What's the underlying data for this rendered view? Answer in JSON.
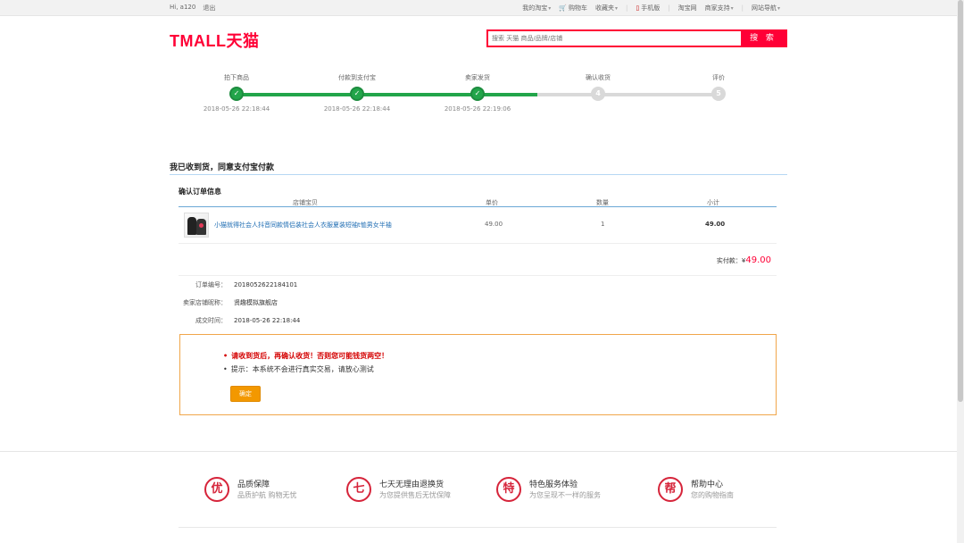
{
  "topbar": {
    "greeting": "Hi,",
    "username": "a120",
    "logout": "退出",
    "my_taobao": "我的淘宝",
    "cart": "购物车",
    "favorites": "收藏夹",
    "mobile": "手机版",
    "taobao": "淘宝网",
    "seller_support": "商家支持",
    "site_nav": "网站导航"
  },
  "header": {
    "logo": "TMALL天猫",
    "search_placeholder": "搜索 天猫 商品/品牌/店铺",
    "search_button": "搜 索"
  },
  "progress": {
    "steps": [
      {
        "label": "拍下商品",
        "status": "done",
        "time": "2018-05-26 22:18:44",
        "mark": "✓"
      },
      {
        "label": "付款到支付宝",
        "status": "done",
        "time": "2018-05-26 22:18:44",
        "mark": "✓"
      },
      {
        "label": "卖家发货",
        "status": "done",
        "time": "2018-05-26 22:19:06",
        "mark": "✓"
      },
      {
        "label": "确认收货",
        "status": "todo",
        "time": "",
        "mark": "4"
      },
      {
        "label": "评价",
        "status": "todo",
        "time": "",
        "mark": "5"
      }
    ],
    "done_color": "#22a54a",
    "todo_color": "#d9d9d9"
  },
  "page_title": "我已收到货，同意支付宝付款",
  "order": {
    "heading": "确认订单信息",
    "columns": [
      "店铺宝贝",
      "单价",
      "数量",
      "小计"
    ],
    "item": {
      "name": "小猫就得社会人抖音同款情侣装社会人衣服夏装短袖t恤男女半袖",
      "price": "49.00",
      "qty": "1",
      "subtotal": "49.00"
    },
    "paid_label": "实付款：",
    "paid_currency": "¥",
    "paid_amount": "49.00",
    "info": [
      {
        "key": "订单编号：",
        "value": "2018052622184101"
      },
      {
        "key": "卖家店铺昵称：",
        "value": "贤趣模拟旗舰店"
      },
      {
        "key": "成交时间：",
        "value": "2018-05-26 22:18:44"
      }
    ]
  },
  "notice": {
    "warning": "请收到货后，再确认收货！否则您可能钱货两空！",
    "tip": "提示：本系统不会进行真实交易，请放心测试",
    "confirm_button": "确定",
    "border_color": "#f0a64a"
  },
  "footer": {
    "features": [
      {
        "icon": "优",
        "title": "品质保障",
        "desc": "品质护航 购物无忧"
      },
      {
        "icon": "七",
        "title": "七天无理由退换货",
        "desc": "为您提供售后无忧保障"
      },
      {
        "icon": "特",
        "title": "特色服务体验",
        "desc": "为您呈现不一样的服务"
      },
      {
        "icon": "帮",
        "title": "帮助中心",
        "desc": "您的购物指南"
      }
    ]
  },
  "colors": {
    "brand": "#ff0036",
    "link": "#1f6db3",
    "warning": "#d40000",
    "button": "#f39800"
  }
}
